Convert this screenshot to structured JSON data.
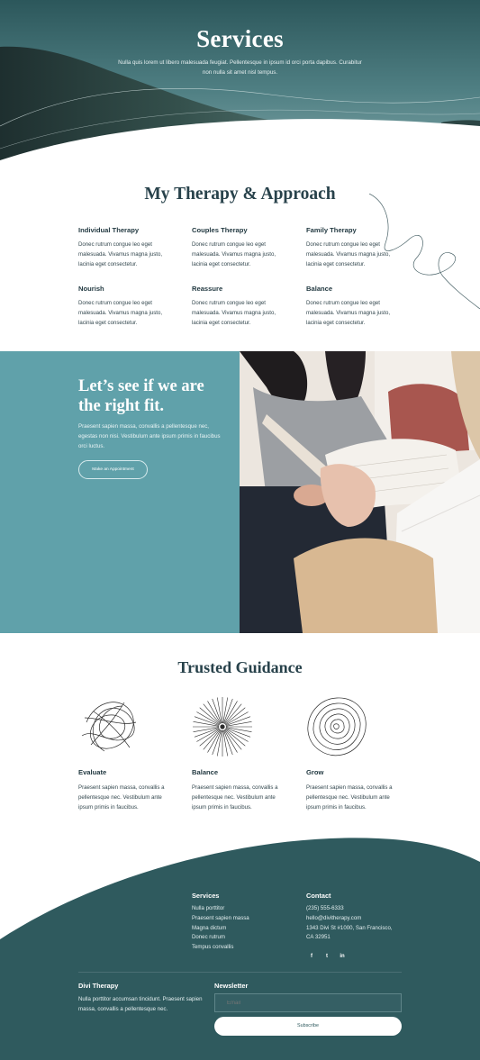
{
  "hero": {
    "title": "Services",
    "subtitle": "Nulla quis lorem ut libero malesuada feugiat. Pellentesque in ipsum id orci porta dapibus. Curabitur non nulla sit amet nisl tempus."
  },
  "approach": {
    "title": "My Therapy & Approach",
    "items": [
      {
        "title": "Individual Therapy",
        "text": "Donec rutrum congue leo eget malesuada. Vivamus magna justo, lacinia eget consectetur."
      },
      {
        "title": "Couples Therapy",
        "text": "Donec rutrum congue leo eget malesuada. Vivamus magna justo, lacinia eget consectetur."
      },
      {
        "title": "Family Therapy",
        "text": "Donec rutrum congue leo eget malesuada. Vivamus magna justo, lacinia eget consectetur."
      },
      {
        "title": "Nourish",
        "text": "Donec rutrum congue leo eget malesuada. Vivamus magna justo, lacinia eget consectetur."
      },
      {
        "title": "Reassure",
        "text": "Donec rutrum congue leo eget malesuada. Vivamus magna justo, lacinia eget consectetur."
      },
      {
        "title": "Balance",
        "text": "Donec rutrum congue leo eget malesuada. Vivamus magna justo, lacinia eget consectetur."
      }
    ]
  },
  "fit": {
    "title": "Let’s see if we are the right fit.",
    "text": "Praesent sapien massa, convallis a pellentesque nec, egestas non nisi. Vestibulum ante ipsum primis in faucibus orci luctus.",
    "button": "Make an Appointment"
  },
  "trusted": {
    "title": "Trusted Guidance",
    "items": [
      {
        "title": "Evaluate",
        "text": "Praesent sapien massa, convallis a pellentesque nec. Vestibulum ante ipsum primis in faucibus."
      },
      {
        "title": "Balance",
        "text": "Praesent sapien massa, convallis a pellentesque nec. Vestibulum ante ipsum primis in faucibus."
      },
      {
        "title": "Grow",
        "text": "Praesent sapien massa, convallis a pellentesque nec. Vestibulum ante ipsum primis in faucibus."
      }
    ]
  },
  "footer": {
    "services_heading": "Services",
    "services_links": [
      "Nulla porttitor",
      "Praesent sapien massa",
      "Magna dictum",
      "Donec rutrum",
      "Tempus convallis"
    ],
    "contact_heading": "Contact",
    "contact_lines": [
      "(235) 555-6333",
      "hello@divitherapy.com",
      "1343 Divi St #1000, San Francisco,",
      "CA 32951"
    ],
    "social": [
      "f",
      "t",
      "in"
    ],
    "brand": "Divi Therapy",
    "brand_text": "Nulla porttitor accumsan tincidunt. Praesent sapien massa, convallis a pellentesque nec.",
    "newsletter_heading": "Newsletter",
    "email_placeholder": "Email",
    "subscribe_label": "Subscribe"
  },
  "colors": {
    "dark_teal": "#2f5a5e",
    "light_teal": "#60a1aa",
    "text": "#2b3f46"
  }
}
